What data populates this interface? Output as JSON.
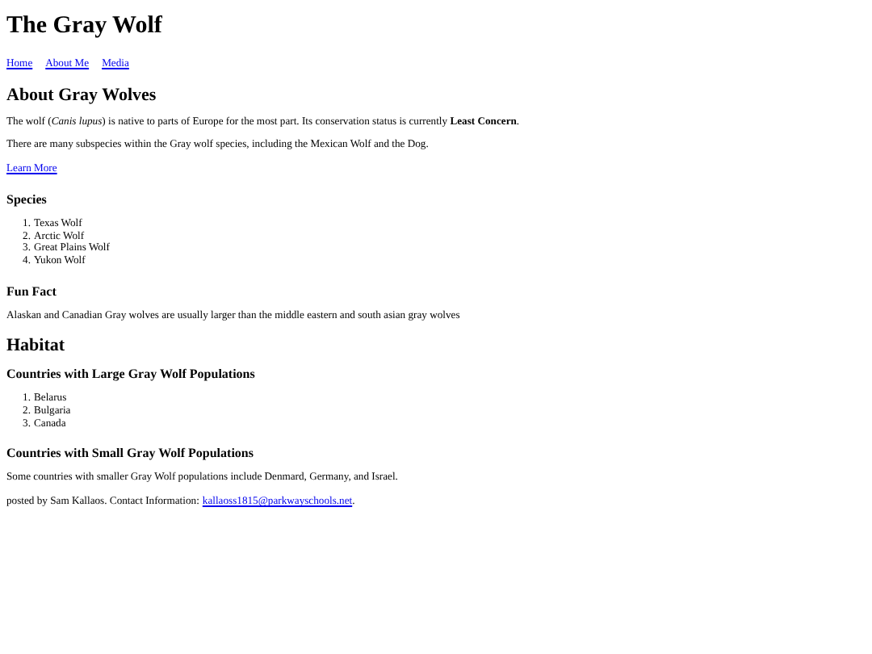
{
  "title": "The Gray Wolf",
  "nav": [
    "Home",
    "About Me",
    "Media"
  ],
  "about": {
    "heading": "About Gray Wolves",
    "paragraphs": [
      "The wolf (*Canis lupus*) is native to parts of Europe for the most part. Its conservation status is currently **Least Concern**.",
      "There are many subspecies within the Gray wolf species, including the Mexican Wolf and the Dog."
    ],
    "link": "Learn More"
  },
  "species": {
    "heading": "Species",
    "items": [
      {
        "number": "1.",
        "text": "Texas Wolf"
      },
      {
        "number": "2.",
        "text": "Arctic Wolf"
      },
      {
        "number": "3.",
        "text": "Great Plains Wolf"
      },
      {
        "number": "4.",
        "text": "Yukon Wolf"
      }
    ]
  },
  "fun_fact": {
    "heading": "Fun Fact",
    "text": "Alaskan and Canadian Gray wolves are usually larger than the middle eastern and south asian gray wolves"
  },
  "habitat": {
    "heading": "Habitat",
    "large": {
      "heading": "Countries with Large Gray Wolf Populations",
      "items": [
        {
          "number": "1.",
          "text": "Belarus"
        },
        {
          "number": "2.",
          "text": "Bulgaria"
        },
        {
          "number": "3.",
          "text": "Canada"
        }
      ]
    },
    "small": {
      "heading": "Countries with Small Gray Wolf Populations",
      "text": "Some countries with smaller Gray Wolf populations include Denmard, Germany, and Israel."
    }
  },
  "footer": {
    "text": "posted by Sam Kallaos. Contact Information:",
    "email": "kallaoss1815@parkwayschools.net",
    "end": "."
  }
}
